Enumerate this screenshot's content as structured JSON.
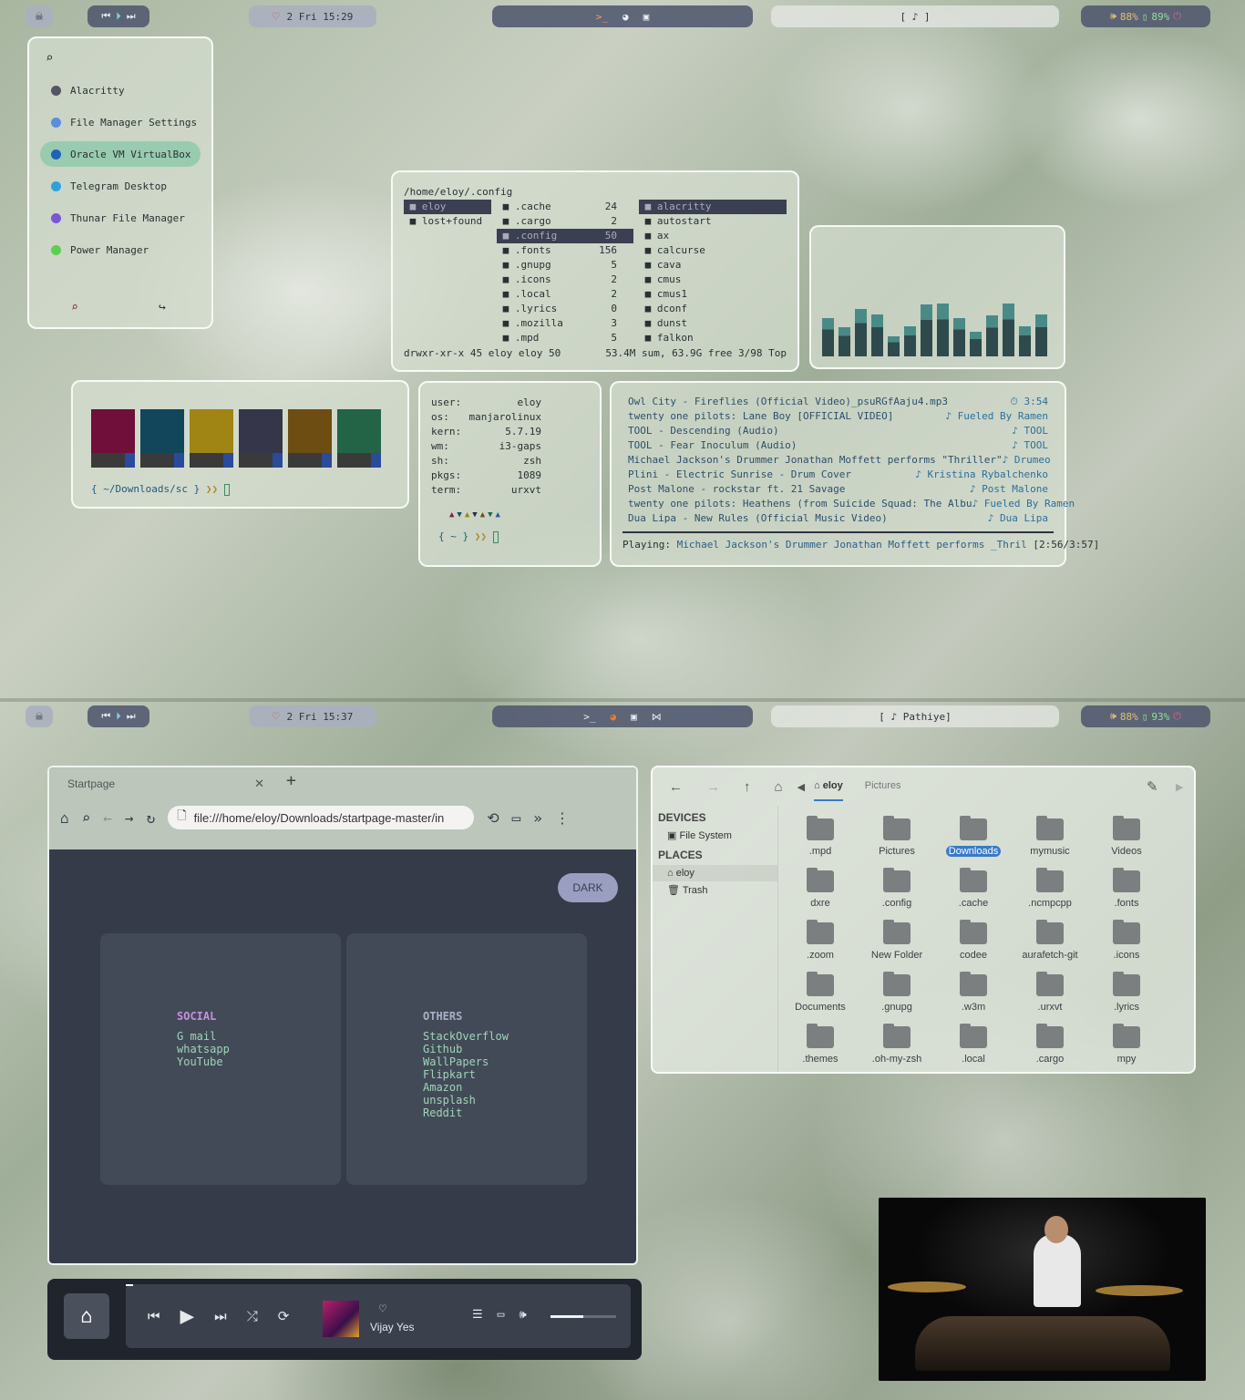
{
  "top": {
    "panel": {
      "date": "2 Fri 15:29",
      "workspace": "[ ♪ ]",
      "volume": "88%",
      "battery": "89%"
    },
    "rofi": {
      "items": [
        {
          "label": "Alacritty",
          "color": "#556"
        },
        {
          "label": "File Manager Settings",
          "color": "#5a8ee0"
        },
        {
          "label": "Oracle VM VirtualBox",
          "color": "#1e63b8"
        },
        {
          "label": "Telegram Desktop",
          "color": "#2aa3dd"
        },
        {
          "label": "Thunar File Manager",
          "color": "#7b55d8"
        },
        {
          "label": "Power Manager",
          "color": "#5ccf4c"
        }
      ]
    },
    "ranger": {
      "path": "/home/eloy/.config",
      "col1": [
        "eloy",
        "lost+found"
      ],
      "col2": [
        {
          "name": ".cache",
          "n": "24"
        },
        {
          "name": ".cargo",
          "n": "2"
        },
        {
          "name": ".config",
          "n": "50"
        },
        {
          "name": ".fonts",
          "n": "156"
        },
        {
          "name": ".gnupg",
          "n": "5"
        },
        {
          "name": ".icons",
          "n": "2"
        },
        {
          "name": ".local",
          "n": "2"
        },
        {
          "name": ".lyrics",
          "n": "0"
        },
        {
          "name": ".mozilla",
          "n": "3"
        },
        {
          "name": ".mpd",
          "n": "5"
        }
      ],
      "col3": [
        "alacritty",
        "autostart",
        "ax",
        "calcurse",
        "cava",
        "cmus",
        "cmus1",
        "dconf",
        "dunst",
        "falkon"
      ],
      "status_left": "drwxr-xr-x 45 eloy eloy 50",
      "status_right": "53.4M sum, 63.9G free  3/98  Top"
    },
    "cava": {
      "bars": [
        0.72,
        0.55,
        0.9,
        0.8,
        0.38,
        0.57,
        0.98,
        1.0,
        0.72,
        0.46,
        0.78,
        1.0,
        0.57,
        0.8
      ]
    },
    "colors": {
      "swatches": [
        "#6f0f3a",
        "#11465b",
        "#a08414",
        "#35364a",
        "#6e4d12",
        "#236446"
      ],
      "prompt": "{ ~/Downloads/sc }"
    },
    "fetch": {
      "rows": [
        {
          "k": "user:",
          "v": "eloy"
        },
        {
          "k": "os:",
          "v": "manjarolinux"
        },
        {
          "k": "kern:",
          "v": "5.7.19"
        },
        {
          "k": "wm:",
          "v": "i3-gaps"
        },
        {
          "k": "sh:",
          "v": "zsh"
        },
        {
          "k": "pkgs:",
          "v": "1089"
        },
        {
          "k": "term:",
          "v": "urxvt"
        }
      ],
      "prompt": "{ ~ }"
    },
    "cmus": {
      "rows": [
        {
          "t": "Owl City - Fireflies (Official Video)_psuRGfAaju4.mp3",
          "a": "3:54"
        },
        {
          "t": "twenty one pilots: Lane Boy [OFFICIAL VIDEO]",
          "a": "Fueled By Ramen"
        },
        {
          "t": "TOOL - Descending (Audio)",
          "a": "TOOL"
        },
        {
          "t": "TOOL - Fear Inoculum (Audio)",
          "a": "TOOL"
        },
        {
          "t": "Michael Jackson's Drummer Jonathan Moffett performs \"Thriller\"",
          "a": "Drumeo"
        },
        {
          "t": "Plini - Electric Sunrise - Drum Cover",
          "a": "Kristina Rybalchenko"
        },
        {
          "t": "Post Malone - rockstar ft. 21 Savage",
          "a": "Post Malone"
        },
        {
          "t": "twenty one pilots: Heathens (from Suicide Squad: The Albu",
          "a": "Fueled By Ramen"
        },
        {
          "t": "Dua Lipa - New Rules (Official Music Video)",
          "a": "Dua Lipa"
        }
      ],
      "playing_label": "Playing:",
      "playing": "Michael Jackson's Drummer Jonathan Moffett performs _Thril",
      "time": "[2:56/3:57]"
    }
  },
  "bottom": {
    "panel": {
      "date": "2 Fri 15:37",
      "workspace": "[ ♪ Pathiye]",
      "volume": "88%",
      "battery": "93%"
    },
    "browser": {
      "tab": "Startpage",
      "url": "file:///home/eloy/Downloads/startpage-master/in",
      "dark_button": "DARK",
      "social_title": "SOCIAL",
      "social_links": [
        "G mail",
        "whatsapp",
        "YouTube"
      ],
      "others_title": "OTHERS",
      "others_links": [
        "StackOverflow",
        "Github",
        "WallPapers",
        "Flipkart",
        "Amazon",
        "unsplash",
        "Reddit"
      ]
    },
    "files": {
      "crumb_current": "eloy",
      "crumb_next": "Pictures",
      "devices_title": "DEVICES",
      "filesystem": "File System",
      "places_title": "PLACES",
      "home": "eloy",
      "trash": "Trash",
      "items": [
        ".mpd",
        "Pictures",
        "Downloads",
        "mymusic",
        "Videos",
        "dxre",
        ".config",
        ".cache",
        ".ncmpcpp",
        ".fonts",
        ".zoom",
        "New Folder",
        "codee",
        "aurafetch-git",
        ".icons",
        "Documents",
        ".gnupg",
        ".w3m",
        ".urxvt",
        ".lyrics",
        ".themes",
        ".oh-my-zsh",
        ".local",
        ".cargo",
        "mpy"
      ],
      "selected": "Downloads"
    },
    "player": {
      "artist": "Vijay Yes",
      "volume": 0.5
    }
  }
}
